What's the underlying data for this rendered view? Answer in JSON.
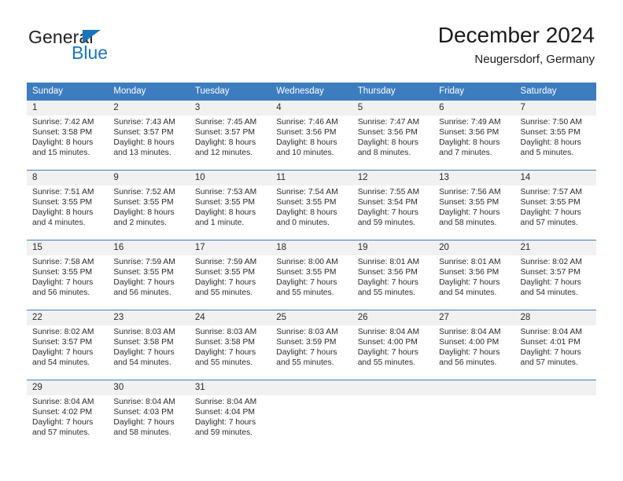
{
  "brand": {
    "name_part1": "General",
    "name_part2": "Blue",
    "triangle_color": "#1b75bc"
  },
  "header": {
    "title": "December 2024",
    "subtitle": "Neugersdorf, Germany"
  },
  "theme": {
    "header_row_bg": "#3d7dbf",
    "daynum_bg": "#f1f1f1",
    "row_rule": "#3d7dbf",
    "text": "#2b2b2b"
  },
  "weekday_headers": [
    "Sunday",
    "Monday",
    "Tuesday",
    "Wednesday",
    "Thursday",
    "Friday",
    "Saturday"
  ],
  "labels": {
    "sunrise_prefix": "Sunrise:",
    "sunset_prefix": "Sunset:",
    "daylight_prefix": "Daylight:"
  },
  "weeks": [
    {
      "days": [
        {
          "date": "1",
          "sunrise": "Sunrise: 7:42 AM",
          "sunset": "Sunset: 3:58 PM",
          "daylight_line1": "Daylight: 8 hours",
          "daylight_line2": "and 15 minutes."
        },
        {
          "date": "2",
          "sunrise": "Sunrise: 7:43 AM",
          "sunset": "Sunset: 3:57 PM",
          "daylight_line1": "Daylight: 8 hours",
          "daylight_line2": "and 13 minutes."
        },
        {
          "date": "3",
          "sunrise": "Sunrise: 7:45 AM",
          "sunset": "Sunset: 3:57 PM",
          "daylight_line1": "Daylight: 8 hours",
          "daylight_line2": "and 12 minutes."
        },
        {
          "date": "4",
          "sunrise": "Sunrise: 7:46 AM",
          "sunset": "Sunset: 3:56 PM",
          "daylight_line1": "Daylight: 8 hours",
          "daylight_line2": "and 10 minutes."
        },
        {
          "date": "5",
          "sunrise": "Sunrise: 7:47 AM",
          "sunset": "Sunset: 3:56 PM",
          "daylight_line1": "Daylight: 8 hours",
          "daylight_line2": "and 8 minutes."
        },
        {
          "date": "6",
          "sunrise": "Sunrise: 7:49 AM",
          "sunset": "Sunset: 3:56 PM",
          "daylight_line1": "Daylight: 8 hours",
          "daylight_line2": "and 7 minutes."
        },
        {
          "date": "7",
          "sunrise": "Sunrise: 7:50 AM",
          "sunset": "Sunset: 3:55 PM",
          "daylight_line1": "Daylight: 8 hours",
          "daylight_line2": "and 5 minutes."
        }
      ]
    },
    {
      "days": [
        {
          "date": "8",
          "sunrise": "Sunrise: 7:51 AM",
          "sunset": "Sunset: 3:55 PM",
          "daylight_line1": "Daylight: 8 hours",
          "daylight_line2": "and 4 minutes."
        },
        {
          "date": "9",
          "sunrise": "Sunrise: 7:52 AM",
          "sunset": "Sunset: 3:55 PM",
          "daylight_line1": "Daylight: 8 hours",
          "daylight_line2": "and 2 minutes."
        },
        {
          "date": "10",
          "sunrise": "Sunrise: 7:53 AM",
          "sunset": "Sunset: 3:55 PM",
          "daylight_line1": "Daylight: 8 hours",
          "daylight_line2": "and 1 minute."
        },
        {
          "date": "11",
          "sunrise": "Sunrise: 7:54 AM",
          "sunset": "Sunset: 3:55 PM",
          "daylight_line1": "Daylight: 8 hours",
          "daylight_line2": "and 0 minutes."
        },
        {
          "date": "12",
          "sunrise": "Sunrise: 7:55 AM",
          "sunset": "Sunset: 3:54 PM",
          "daylight_line1": "Daylight: 7 hours",
          "daylight_line2": "and 59 minutes."
        },
        {
          "date": "13",
          "sunrise": "Sunrise: 7:56 AM",
          "sunset": "Sunset: 3:55 PM",
          "daylight_line1": "Daylight: 7 hours",
          "daylight_line2": "and 58 minutes."
        },
        {
          "date": "14",
          "sunrise": "Sunrise: 7:57 AM",
          "sunset": "Sunset: 3:55 PM",
          "daylight_line1": "Daylight: 7 hours",
          "daylight_line2": "and 57 minutes."
        }
      ]
    },
    {
      "days": [
        {
          "date": "15",
          "sunrise": "Sunrise: 7:58 AM",
          "sunset": "Sunset: 3:55 PM",
          "daylight_line1": "Daylight: 7 hours",
          "daylight_line2": "and 56 minutes."
        },
        {
          "date": "16",
          "sunrise": "Sunrise: 7:59 AM",
          "sunset": "Sunset: 3:55 PM",
          "daylight_line1": "Daylight: 7 hours",
          "daylight_line2": "and 56 minutes."
        },
        {
          "date": "17",
          "sunrise": "Sunrise: 7:59 AM",
          "sunset": "Sunset: 3:55 PM",
          "daylight_line1": "Daylight: 7 hours",
          "daylight_line2": "and 55 minutes."
        },
        {
          "date": "18",
          "sunrise": "Sunrise: 8:00 AM",
          "sunset": "Sunset: 3:55 PM",
          "daylight_line1": "Daylight: 7 hours",
          "daylight_line2": "and 55 minutes."
        },
        {
          "date": "19",
          "sunrise": "Sunrise: 8:01 AM",
          "sunset": "Sunset: 3:56 PM",
          "daylight_line1": "Daylight: 7 hours",
          "daylight_line2": "and 55 minutes."
        },
        {
          "date": "20",
          "sunrise": "Sunrise: 8:01 AM",
          "sunset": "Sunset: 3:56 PM",
          "daylight_line1": "Daylight: 7 hours",
          "daylight_line2": "and 54 minutes."
        },
        {
          "date": "21",
          "sunrise": "Sunrise: 8:02 AM",
          "sunset": "Sunset: 3:57 PM",
          "daylight_line1": "Daylight: 7 hours",
          "daylight_line2": "and 54 minutes."
        }
      ]
    },
    {
      "days": [
        {
          "date": "22",
          "sunrise": "Sunrise: 8:02 AM",
          "sunset": "Sunset: 3:57 PM",
          "daylight_line1": "Daylight: 7 hours",
          "daylight_line2": "and 54 minutes."
        },
        {
          "date": "23",
          "sunrise": "Sunrise: 8:03 AM",
          "sunset": "Sunset: 3:58 PM",
          "daylight_line1": "Daylight: 7 hours",
          "daylight_line2": "and 54 minutes."
        },
        {
          "date": "24",
          "sunrise": "Sunrise: 8:03 AM",
          "sunset": "Sunset: 3:58 PM",
          "daylight_line1": "Daylight: 7 hours",
          "daylight_line2": "and 55 minutes."
        },
        {
          "date": "25",
          "sunrise": "Sunrise: 8:03 AM",
          "sunset": "Sunset: 3:59 PM",
          "daylight_line1": "Daylight: 7 hours",
          "daylight_line2": "and 55 minutes."
        },
        {
          "date": "26",
          "sunrise": "Sunrise: 8:04 AM",
          "sunset": "Sunset: 4:00 PM",
          "daylight_line1": "Daylight: 7 hours",
          "daylight_line2": "and 55 minutes."
        },
        {
          "date": "27",
          "sunrise": "Sunrise: 8:04 AM",
          "sunset": "Sunset: 4:00 PM",
          "daylight_line1": "Daylight: 7 hours",
          "daylight_line2": "and 56 minutes."
        },
        {
          "date": "28",
          "sunrise": "Sunrise: 8:04 AM",
          "sunset": "Sunset: 4:01 PM",
          "daylight_line1": "Daylight: 7 hours",
          "daylight_line2": "and 57 minutes."
        }
      ]
    },
    {
      "days": [
        {
          "date": "29",
          "sunrise": "Sunrise: 8:04 AM",
          "sunset": "Sunset: 4:02 PM",
          "daylight_line1": "Daylight: 7 hours",
          "daylight_line2": "and 57 minutes."
        },
        {
          "date": "30",
          "sunrise": "Sunrise: 8:04 AM",
          "sunset": "Sunset: 4:03 PM",
          "daylight_line1": "Daylight: 7 hours",
          "daylight_line2": "and 58 minutes."
        },
        {
          "date": "31",
          "sunrise": "Sunrise: 8:04 AM",
          "sunset": "Sunset: 4:04 PM",
          "daylight_line1": "Daylight: 7 hours",
          "daylight_line2": "and 59 minutes."
        },
        {
          "date": "",
          "sunrise": "",
          "sunset": "",
          "daylight_line1": "",
          "daylight_line2": ""
        },
        {
          "date": "",
          "sunrise": "",
          "sunset": "",
          "daylight_line1": "",
          "daylight_line2": ""
        },
        {
          "date": "",
          "sunrise": "",
          "sunset": "",
          "daylight_line1": "",
          "daylight_line2": ""
        },
        {
          "date": "",
          "sunrise": "",
          "sunset": "",
          "daylight_line1": "",
          "daylight_line2": ""
        }
      ]
    }
  ]
}
